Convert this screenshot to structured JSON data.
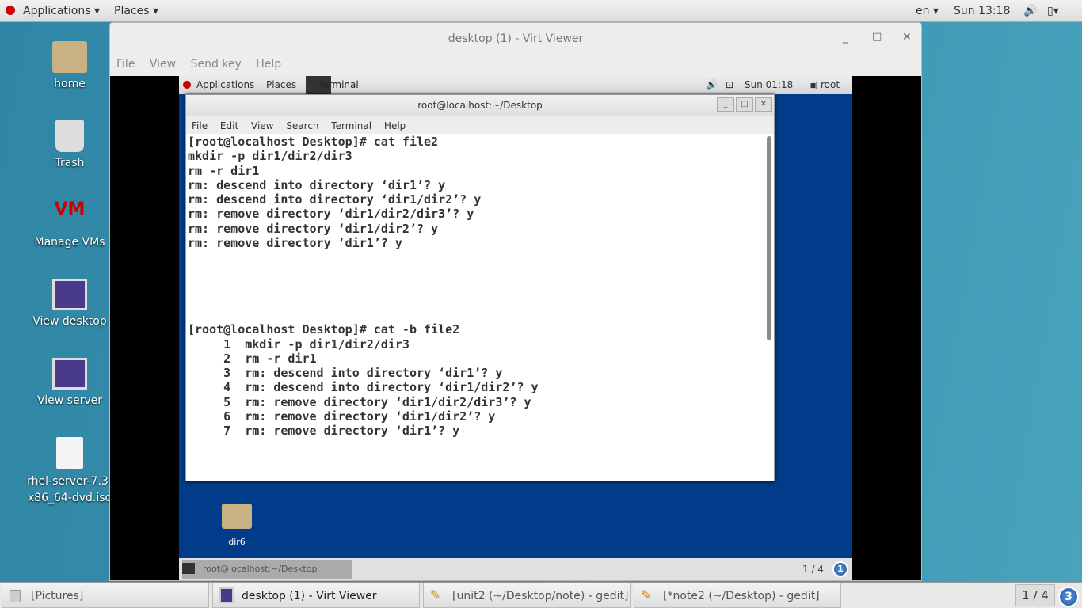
{
  "topbar": {
    "applications": "Applications ▾",
    "places": "Places ▾",
    "lang": "en ▾",
    "clock": "Sun 13:18"
  },
  "desktop_icons": [
    {
      "label": "home",
      "icon": "home-folder-icon"
    },
    {
      "label": "Trash",
      "icon": "trash-icon"
    },
    {
      "label": "Manage VMs",
      "icon": "virt-manager-icon"
    },
    {
      "label": "View desktop",
      "icon": "monitor-icon"
    },
    {
      "label": "View server",
      "icon": "monitor-icon"
    },
    {
      "label": "rhel-server-7.3-x86_64-dvd.iso",
      "label_line1": "rhel-server-7.3-",
      "label_line2": "x86_64-dvd.iso",
      "icon": "disc-image-icon"
    }
  ],
  "virt_viewer": {
    "title": "desktop (1) - Virt Viewer",
    "menu": [
      "File",
      "View",
      "Send key",
      "Help"
    ]
  },
  "guest": {
    "topbar": {
      "applications": "Applications",
      "places": "Places",
      "terminal": "Terminal",
      "clock": "Sun 01:18",
      "user": "root"
    },
    "terminal": {
      "title": "root@localhost:~/Desktop",
      "menu": [
        "File",
        "Edit",
        "View",
        "Search",
        "Terminal",
        "Help"
      ],
      "content": "[root@localhost Desktop]# cat file2\nmkdir -p dir1/dir2/dir3\nrm -r dir1\nrm: descend into directory ‘dir1’? y\nrm: descend into directory ‘dir1/dir2’? y\nrm: remove directory ‘dir1/dir2/dir3’? y\nrm: remove directory ‘dir1/dir2’? y\nrm: remove directory ‘dir1’? y\n\n\n\n\n\n[root@localhost Desktop]# cat -b file2\n     1\tmkdir -p dir1/dir2/dir3\n     2\trm -r dir1\n     3\trm: descend into directory ‘dir1’? y\n     4\trm: descend into directory ‘dir1/dir2’? y\n     5\trm: remove directory ‘dir1/dir2/dir3’? y\n     6\trm: remove directory ‘dir1/dir2’? y\n     7\trm: remove directory ‘dir1’? y"
    },
    "desktop_folder": "dir6",
    "taskbar": {
      "item": "root@localhost:~/Desktop",
      "workspace": "1 / 4",
      "badge": "1"
    }
  },
  "host_taskbar": {
    "items": [
      "[Pictures]",
      "desktop (1) - Virt Viewer",
      "[unit2 (~/Desktop/note) - gedit]",
      "[*note2 (~/Desktop) - gedit]"
    ],
    "workspace": "1 / 4",
    "badge": "3"
  }
}
